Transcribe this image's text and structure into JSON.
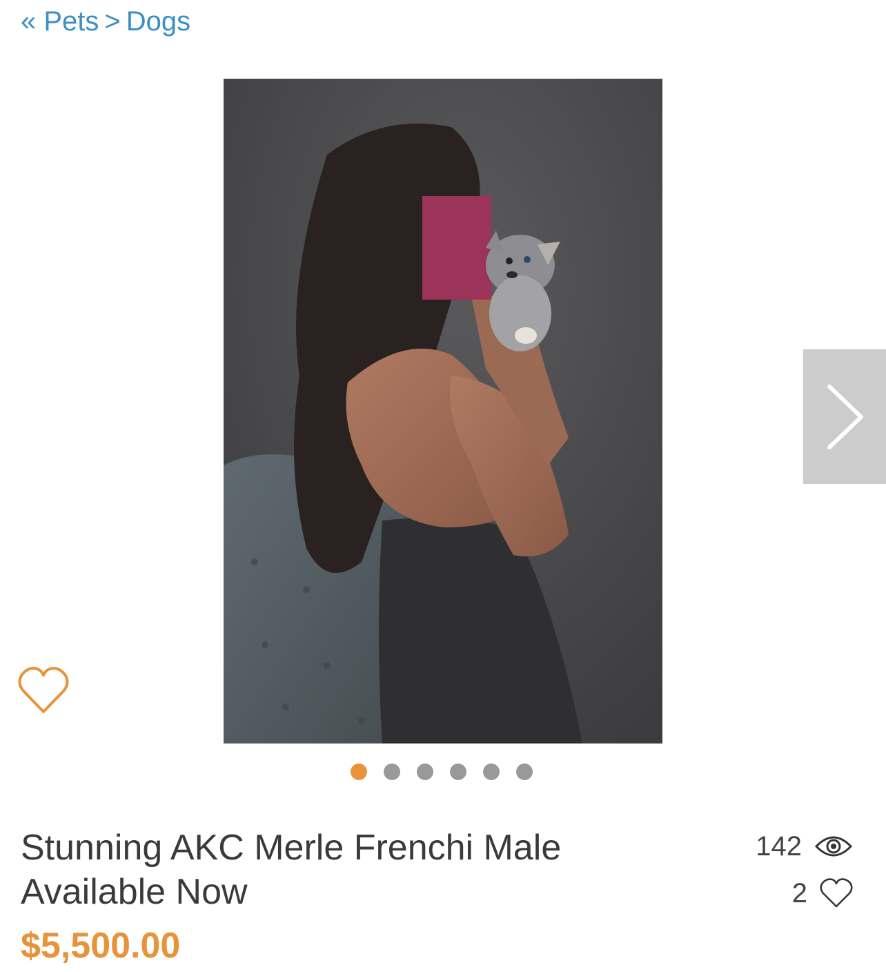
{
  "breadcrumb": {
    "back_symbol": "«",
    "parent": "Pets",
    "separator": ">",
    "current": "Dogs"
  },
  "listing": {
    "title": "Stunning AKC Merle Frenchi Male Available Now",
    "price": "$5,500.00",
    "views": "142",
    "likes": "2"
  },
  "gallery": {
    "total_images": 6,
    "active_index": 0
  },
  "colors": {
    "link": "#3b8fc4",
    "accent": "#e8933a",
    "text": "#3a3a3a",
    "nav_bg": "#cccccc",
    "dot_inactive": "#999999"
  },
  "icons": {
    "next": "chevron-right-icon",
    "favorite": "heart-outline-icon",
    "views": "eye-icon",
    "likes": "heart-outline-icon"
  }
}
